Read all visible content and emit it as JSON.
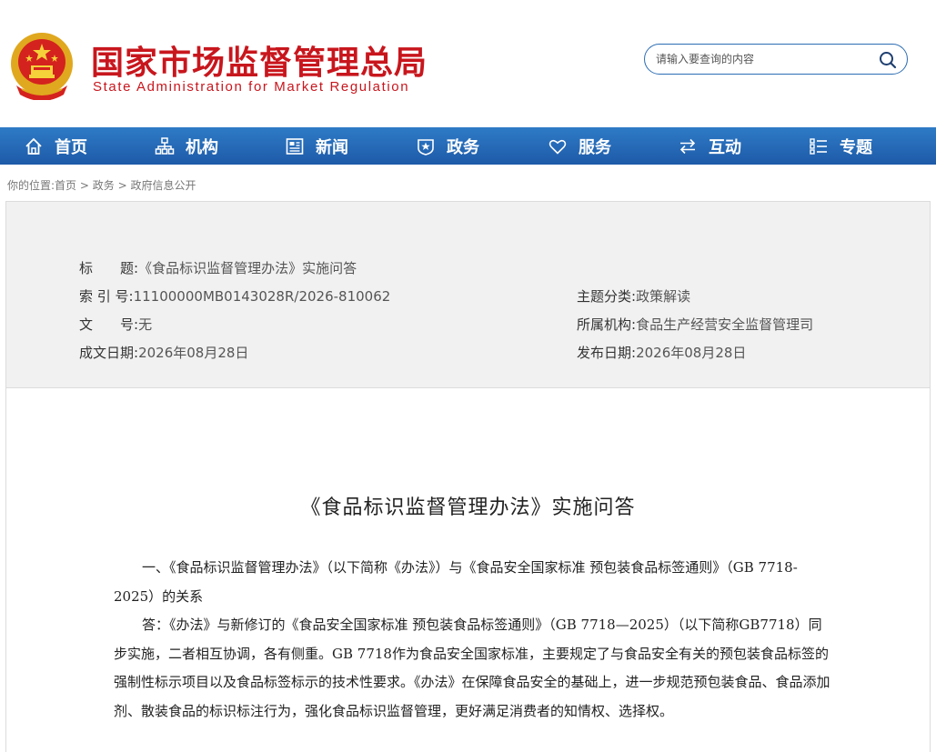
{
  "header": {
    "title": "国家市场监督管理总局",
    "subtitle": "State Administration for Market Regulation",
    "search_placeholder": "请输入要查询的内容"
  },
  "nav": {
    "items": [
      {
        "label": "首页",
        "icon": "home-icon"
      },
      {
        "label": "机构",
        "icon": "org-chart-icon"
      },
      {
        "label": "新闻",
        "icon": "newspaper-icon"
      },
      {
        "label": "政务",
        "icon": "badge-icon"
      },
      {
        "label": "服务",
        "icon": "heart-icon"
      },
      {
        "label": "互动",
        "icon": "exchange-arrows-icon"
      },
      {
        "label": "专题",
        "icon": "list-icon"
      }
    ]
  },
  "breadcrumb": {
    "prefix": "你的位置:",
    "items": [
      "首页",
      "政务",
      "政府信息公开"
    ],
    "separator": ">"
  },
  "meta": {
    "title_label": "标　　题:",
    "title_value": "《食品标识监督管理办法》实施问答",
    "index_label": "索 引 号:",
    "index_value": "11100000MB0143028R/2026-810062",
    "doc_no_label": "文　　号:",
    "doc_no_value": "无",
    "written_date_label": "成文日期:",
    "written_date_value": "2026年08月28日",
    "topic_label": "主题分类:",
    "topic_value": "政策解读",
    "org_label": "所属机构:",
    "org_value": "食品生产经营安全监督管理司",
    "publish_date_label": "发布日期:",
    "publish_date_value": "2026年08月28日"
  },
  "article": {
    "title": "《食品标识监督管理办法》实施问答",
    "paragraphs": [
      "一、《食品标识监督管理办法》（以下简称《办法》）与《食品安全国家标准 预包装食品标签通则》（GB 7718-2025）的关系",
      "答：《办法》与新修订的《食品安全国家标准 预包装食品标签通则》（GB 7718—2025）（以下简称GB7718）同步实施，二者相互协调，各有侧重。GB 7718作为食品安全国家标准，主要规定了与食品安全有关的预包装食品标签的强制性标示项目以及食品标签标示的技术性要求。《办法》在保障食品安全的基础上，进一步规范预包装食品、食品添加剂、散装食品的标识标注行为，强化食品标识监督管理，更好满足消费者的知情权、选择权。"
    ]
  },
  "colors": {
    "brand_red": "#c8161d",
    "nav_blue": "#1e5aa8",
    "meta_bg": "#f1f1f1"
  }
}
